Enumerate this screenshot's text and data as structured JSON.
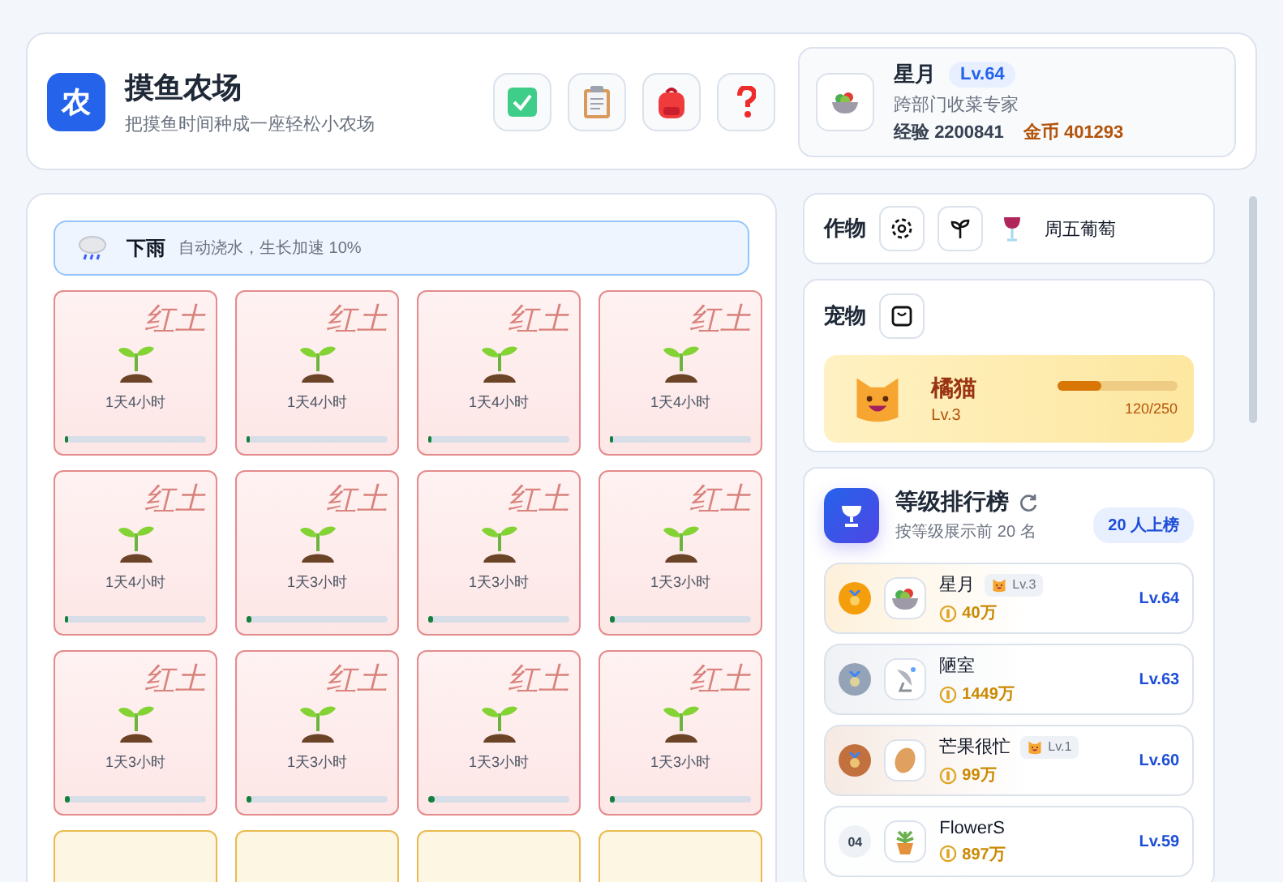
{
  "header": {
    "logo": "农",
    "title": "摸鱼农场",
    "subtitle": "把摸鱼时间种成一座轻松小农场"
  },
  "profile": {
    "name": "星月",
    "level": "Lv.64",
    "role": "跨部门收菜专家",
    "exp_label": "经验",
    "exp": "2200841",
    "coin_label": "金币",
    "coins": "401293"
  },
  "weather": {
    "title": "下雨",
    "desc": "自动浇水，生长加速 10%"
  },
  "plots": [
    {
      "kind": "crop",
      "soil": "红土",
      "time": "1天4小时",
      "level": 0.01
    },
    {
      "kind": "crop",
      "soil": "红土",
      "time": "1天4小时",
      "level": 0.01
    },
    {
      "kind": "crop",
      "soil": "红土",
      "time": "1天4小时",
      "level": 0.01
    },
    {
      "kind": "crop",
      "soil": "红土",
      "time": "1天4小时",
      "level": 0.01
    },
    {
      "kind": "crop",
      "soil": "红土",
      "time": "1天4小时",
      "level": 0.01
    },
    {
      "kind": "crop",
      "soil": "红土",
      "time": "1天3小时",
      "level": 0.03
    },
    {
      "kind": "crop",
      "soil": "红土",
      "time": "1天3小时",
      "level": 0.03
    },
    {
      "kind": "crop",
      "soil": "红土",
      "time": "1天3小时",
      "level": 0.03
    },
    {
      "kind": "crop",
      "soil": "红土",
      "time": "1天3小时",
      "level": 0.03
    },
    {
      "kind": "crop",
      "soil": "红土",
      "time": "1天3小时",
      "level": 0.03
    },
    {
      "kind": "crop",
      "soil": "红土",
      "time": "1天3小时",
      "level": 0.05
    },
    {
      "kind": "crop",
      "soil": "红土",
      "time": "1天3小时",
      "level": 0.03
    },
    {
      "kind": "empty"
    },
    {
      "kind": "empty"
    },
    {
      "kind": "empty"
    },
    {
      "kind": "empty"
    }
  ],
  "crops": {
    "title": "作物",
    "current": "周五葡萄"
  },
  "pets": {
    "title": "宠物",
    "name": "橘猫",
    "level_text": "Lv.3",
    "progress": "120/250",
    "level": 0.36
  },
  "leaderboard": {
    "title": "等级排行榜",
    "subtitle": "按等级展示前 20 名",
    "badge": "20 人上榜",
    "rows": [
      {
        "kind": "medal",
        "color": "#f59e0b",
        "name": "星月",
        "pet": "Lv.3",
        "coins": "40万",
        "level": "Lv.64"
      },
      {
        "kind": "medal",
        "color": "#94a3b8",
        "name": "陋室",
        "coins": "1449万",
        "level": "Lv.63"
      },
      {
        "kind": "medal",
        "color": "#c2703d",
        "name": "芒果很忙",
        "pet": "Lv.1",
        "coins": "99万",
        "level": "Lv.60"
      },
      {
        "kind": "number",
        "rank": "04",
        "name": "FlowerS",
        "coins": "897万",
        "level": "Lv.59"
      }
    ]
  }
}
